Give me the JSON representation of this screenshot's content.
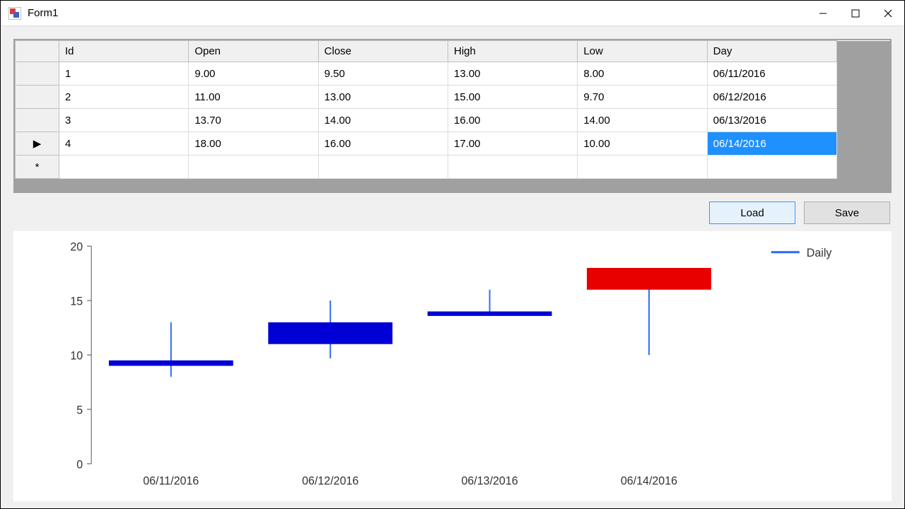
{
  "window": {
    "title": "Form1"
  },
  "grid": {
    "columns": [
      "Id",
      "Open",
      "Close",
      "High",
      "Low",
      "Day"
    ],
    "rows": [
      {
        "Id": "1",
        "Open": "9.00",
        "Close": "9.50",
        "High": "13.00",
        "Low": "8.00",
        "Day": "06/11/2016"
      },
      {
        "Id": "2",
        "Open": "11.00",
        "Close": "13.00",
        "High": "15.00",
        "Low": "9.70",
        "Day": "06/12/2016"
      },
      {
        "Id": "3",
        "Open": "13.70",
        "Close": "14.00",
        "High": "16.00",
        "Low": "14.00",
        "Day": "06/13/2016"
      },
      {
        "Id": "4",
        "Open": "18.00",
        "Close": "16.00",
        "High": "17.00",
        "Low": "10.00",
        "Day": "06/14/2016"
      }
    ],
    "current_row_index": 3,
    "selected_cell": {
      "row": 3,
      "col": "Day"
    },
    "new_row_marker": "*",
    "current_row_marker": "▶"
  },
  "buttons": {
    "load": "Load",
    "save": "Save"
  },
  "legend": {
    "series": "Daily"
  },
  "chart_data": {
    "type": "candlestick",
    "categories": [
      "06/11/2016",
      "06/12/2016",
      "06/13/2016",
      "06/14/2016"
    ],
    "series": [
      {
        "name": "Daily",
        "values": [
          {
            "open": 9.0,
            "close": 9.5,
            "high": 13.0,
            "low": 8.0
          },
          {
            "open": 11.0,
            "close": 13.0,
            "high": 15.0,
            "low": 9.7
          },
          {
            "open": 13.7,
            "close": 14.0,
            "high": 16.0,
            "low": 14.0
          },
          {
            "open": 18.0,
            "close": 16.0,
            "high": 17.0,
            "low": 10.0
          }
        ]
      }
    ],
    "ylabel": "",
    "xlabel": "",
    "title": "",
    "ylim": [
      0,
      20
    ],
    "yticks": [
      0,
      5,
      10,
      15,
      20
    ],
    "colors": {
      "up": "#0000d6",
      "down": "#e80000",
      "wick": "#2e6dff"
    }
  }
}
